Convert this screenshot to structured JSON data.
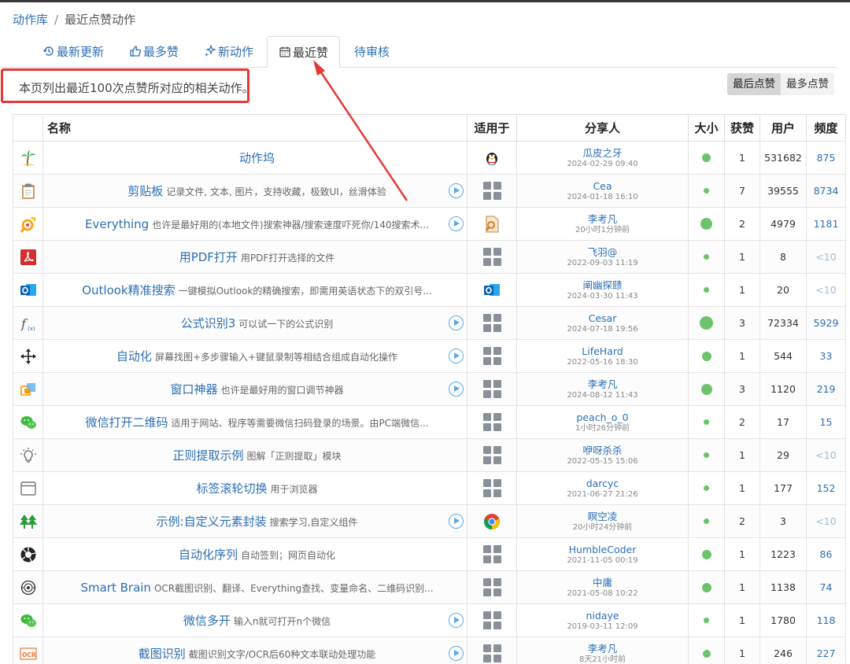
{
  "breadcrumb": {
    "home": "动作库",
    "separator": "/",
    "current": "最近点赞动作"
  },
  "tabs": [
    {
      "label": "最新更新",
      "icon": "history-icon"
    },
    {
      "label": "最多赞",
      "icon": "thumbs-up-icon"
    },
    {
      "label": "新动作",
      "icon": "sparkle-icon"
    },
    {
      "label": "最近赞",
      "icon": "calendar-icon",
      "active": true
    },
    {
      "label": "待审核",
      "icon": ""
    }
  ],
  "description": "本页列出最近100次点赞所对应的相关动作。",
  "sort": {
    "last_like": "最后点赞",
    "most_like": "最多点赞"
  },
  "columns": {
    "name": "名称",
    "applies_to": "适用于",
    "sharer": "分享人",
    "size": "大小",
    "likes": "获赞",
    "users": "用户",
    "frequency": "频度"
  },
  "rows": [
    {
      "icon": "palm-tree-icon",
      "name": "动作坞",
      "desc": "",
      "play": false,
      "applies": "penguin-icon",
      "sharer": "瓜皮之牙",
      "date": "2024-02-29 09:40",
      "size": 0.5,
      "likes": "1",
      "users": "531682",
      "freq": "875"
    },
    {
      "icon": "clipboard-icon",
      "name": "剪贴板",
      "desc": "记录文件, 文本, 图片，支持收藏，极致UI，丝滑体验",
      "play": true,
      "applies": "windows-icon",
      "sharer": "Cea",
      "date": "2024-01-18 16:10",
      "size": 0.2,
      "likes": "7",
      "users": "39555",
      "freq": "8734"
    },
    {
      "icon": "everything-icon",
      "name": "Everything",
      "desc": "也许是最好用的(本地文件)搜索神器/搜索速度吓死你/140搜索术...",
      "play": true,
      "applies": "file-search-icon",
      "sharer": "李考凡",
      "date": "20小时1分钟前",
      "size": 0.8,
      "likes": "2",
      "users": "4979",
      "freq": "1181"
    },
    {
      "icon": "pdf-icon",
      "name": "用PDF打开",
      "desc": "用PDF打开选择的文件",
      "play": false,
      "applies": "windows-icon",
      "sharer": "飞羽@",
      "date": "2022-09-03 11:19",
      "size": 0.2,
      "likes": "1",
      "users": "8",
      "freq": "<10"
    },
    {
      "icon": "outlook-icon",
      "name": "Outlook精准搜索",
      "desc": "一键模拟Outlook的精确搜索，即需用英语状态下的双引号...",
      "play": false,
      "applies": "outlook-icon",
      "sharer": "阐幽探赜",
      "date": "2024-03-30 11:43",
      "size": 0.2,
      "likes": "1",
      "users": "20",
      "freq": "<10"
    },
    {
      "icon": "formula-icon",
      "name": "公式识别3",
      "desc": "可以试一下的公式识别",
      "play": true,
      "applies": "windows-icon",
      "sharer": "Cesar",
      "date": "2024-07-18 19:56",
      "size": 0.9,
      "likes": "3",
      "users": "72334",
      "freq": "5929"
    },
    {
      "icon": "move-arrows-icon",
      "name": "自动化",
      "desc": "屏幕找图+多步骤输入+键鼠录制等相结合组成自动化操作",
      "play": true,
      "applies": "windows-icon",
      "sharer": "LifeHard",
      "date": "2022-05-16 18:30",
      "size": 0.6,
      "likes": "1",
      "users": "544",
      "freq": "33"
    },
    {
      "icon": "window-icon",
      "name": "窗口神器",
      "desc": "也许是最好用的窗口调节神器",
      "play": true,
      "applies": "windows-icon",
      "sharer": "李考凡",
      "date": "2024-08-12 11:43",
      "size": 0.7,
      "likes": "3",
      "users": "1120",
      "freq": "219"
    },
    {
      "icon": "wechat-icon",
      "name": "微信打开二维码",
      "desc": "适用于网站、程序等需要微信扫码登录的场景。由PC端微信...",
      "play": false,
      "applies": "windows-icon",
      "sharer": "peach_o_0",
      "date": "1小时26分钟前",
      "size": 0.2,
      "likes": "2",
      "users": "17",
      "freq": "15"
    },
    {
      "icon": "bulb-icon",
      "name": "正则提取示例",
      "desc": "图解「正则提取」模块",
      "play": false,
      "applies": "windows-icon",
      "sharer": "咿呀杀杀",
      "date": "2022-05-15 15:06",
      "size": 0.2,
      "likes": "1",
      "users": "29",
      "freq": "<10"
    },
    {
      "icon": "browser-icon",
      "name": "标签滚轮切换",
      "desc": "用于浏览器",
      "play": false,
      "applies": "windows-icon",
      "sharer": "darcyc",
      "date": "2021-06-27 21:26",
      "size": 0.2,
      "likes": "1",
      "users": "177",
      "freq": "152"
    },
    {
      "icon": "trees-icon",
      "name": "示例:自定义元素封装",
      "desc": "搜索学习,自定义组件",
      "play": true,
      "applies": "chrome-icon",
      "sharer": "瞑空凌",
      "date": "20小时24分钟前",
      "size": 0.2,
      "likes": "2",
      "users": "3",
      "freq": "<10"
    },
    {
      "icon": "aperture-icon",
      "name": "自动化序列",
      "desc": "自动签到；网页自动化",
      "play": false,
      "applies": "windows-icon",
      "sharer": "HumbleCoder",
      "date": "2021-11-05 00:19",
      "size": 0.6,
      "likes": "1",
      "users": "1223",
      "freq": "86"
    },
    {
      "icon": "brain-icon",
      "name": "Smart Brain",
      "desc": "OCR截图识别、翻译、Everything查找、变量命名、二维码识别...",
      "play": false,
      "applies": "windows-icon",
      "sharer": "中庸",
      "date": "2021-05-08 10:22",
      "size": 0.6,
      "likes": "1",
      "users": "1138",
      "freq": "74"
    },
    {
      "icon": "wechat-icon",
      "name": "微信多开",
      "desc": "输入n就可打开n个微信",
      "play": true,
      "applies": "windows-icon",
      "sharer": "nidaye",
      "date": "2019-03-11 12:09",
      "size": 0.2,
      "likes": "1",
      "users": "1780",
      "freq": "118"
    },
    {
      "icon": "ocr-icon",
      "name": "截图识别",
      "desc": "截图识别文字/OCR后60种文本联动处理功能",
      "play": true,
      "applies": "windows-icon",
      "sharer": "李考凡",
      "date": "8天21小时前",
      "size": 0.4,
      "likes": "1",
      "users": "246",
      "freq": "227"
    }
  ],
  "colors": {
    "link": "#2d6fb3",
    "annotation": "#e53935",
    "dot": "#6cc36c"
  }
}
